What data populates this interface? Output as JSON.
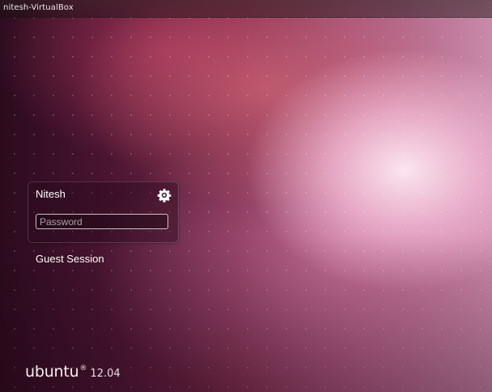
{
  "topbar": {
    "hostname": "nitesh-VirtualBox"
  },
  "login": {
    "username": "Nitesh",
    "settings_icon": "gear-icon",
    "password": {
      "value": "",
      "placeholder": "Password"
    }
  },
  "guest_session_label": "Guest Session",
  "branding": {
    "name": "ubuntu",
    "registered_mark": "®",
    "version": "12.04"
  }
}
